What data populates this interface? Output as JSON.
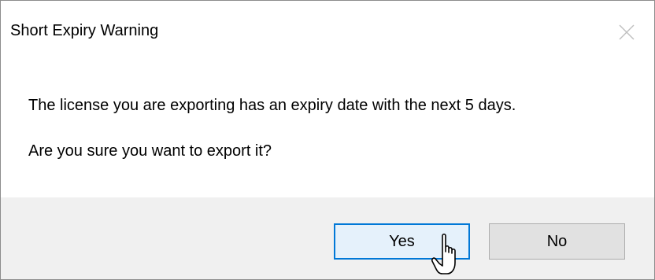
{
  "dialog": {
    "title": "Short Expiry Warning",
    "close_icon": "close-icon",
    "message_line1": "The license you are exporting has an expiry date with the next 5 days.",
    "message_line2": "Are you sure you want to export it?"
  },
  "buttons": {
    "yes_label": "Yes",
    "no_label": "No"
  },
  "cursor": {
    "icon": "pointer-cursor-icon"
  },
  "colors": {
    "footer_bg": "#f0f0f0",
    "default_button_border": "#0078d7",
    "default_button_bg": "#e5f1fb",
    "button_bg": "#e1e1e1",
    "button_border": "#adadad"
  }
}
